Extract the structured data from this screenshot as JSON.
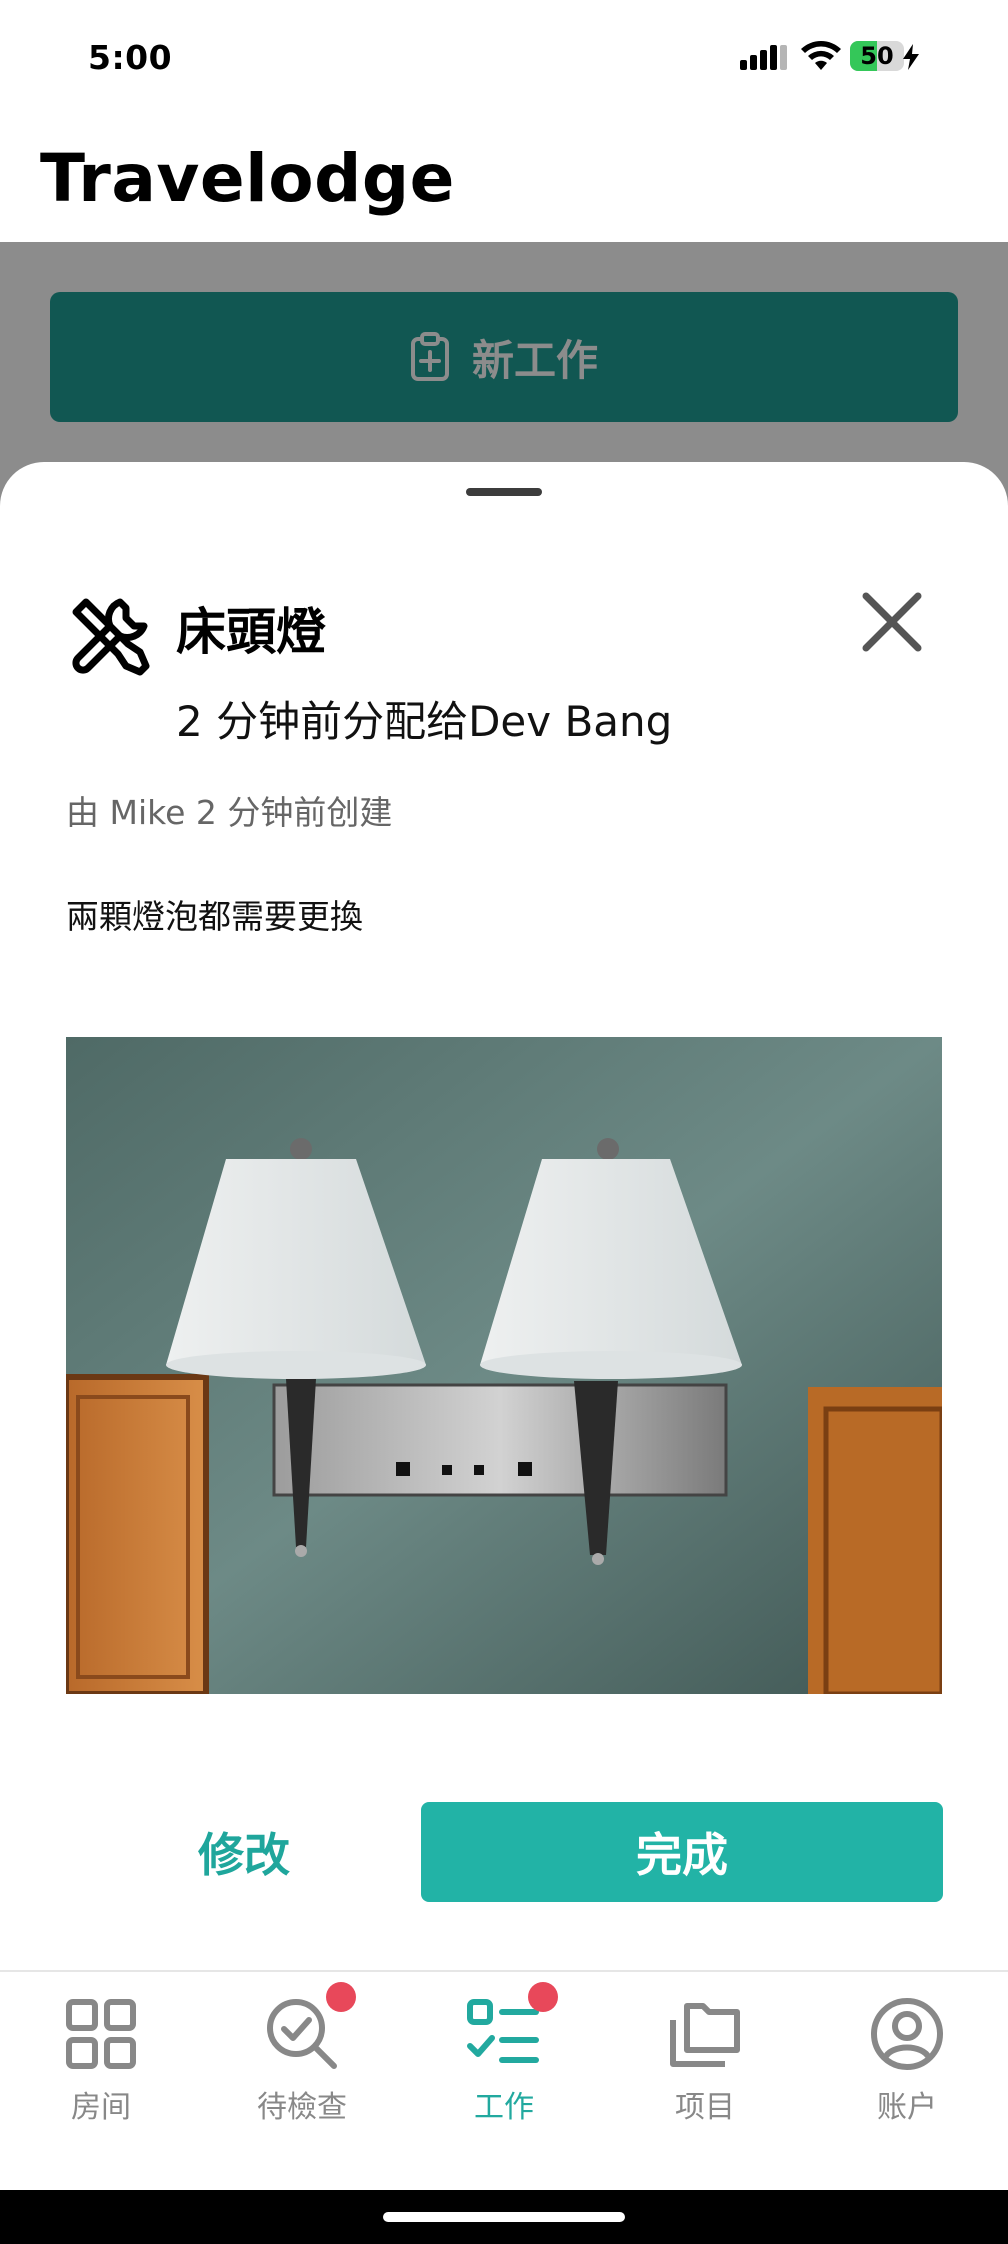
{
  "status_bar": {
    "time": "5:00",
    "battery": "50",
    "battery_level": 0.5
  },
  "app": {
    "title": "Travelodge"
  },
  "background": {
    "new_job_label": "新工作"
  },
  "job": {
    "title": "床頭燈",
    "assigned": "2 分钟前分配给Dev Bang",
    "created": "由 Mike 2 分钟前创建",
    "description": "兩顆燈泡都需要更換"
  },
  "actions": {
    "edit_label": "修改",
    "done_label": "完成"
  },
  "colors": {
    "accent": "#22b3a6",
    "accent_dark": "#1f9e95",
    "badge": "#e8485a",
    "tab_inactive": "#888888"
  },
  "tabs": [
    {
      "label": "房间",
      "icon": "grid-icon",
      "badge": false,
      "active": false
    },
    {
      "label": "待檢查",
      "icon": "inspect-search-icon",
      "badge": true,
      "active": false
    },
    {
      "label": "工作",
      "icon": "task-list-icon",
      "badge": true,
      "active": true
    },
    {
      "label": "项目",
      "icon": "folders-icon",
      "badge": false,
      "active": false
    },
    {
      "label": "账户",
      "icon": "account-icon",
      "badge": false,
      "active": false
    }
  ]
}
